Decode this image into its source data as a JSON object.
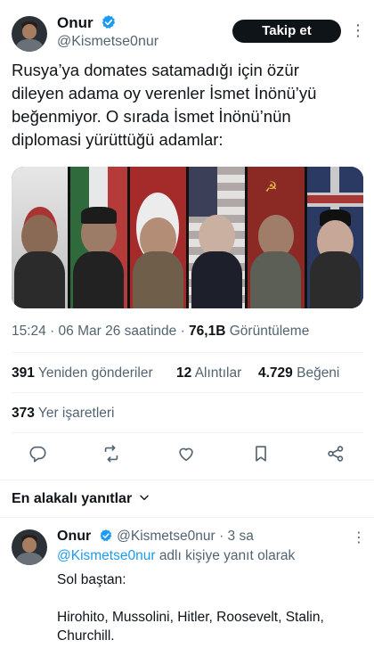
{
  "tweet": {
    "author_name": "Onur",
    "author_handle": "@Kismetse0nur",
    "follow_label": "Takip et",
    "text_lines": [
      "Rusya’ya domates satamadığı için özür",
      "dileyen adama oy verenler İsmet İnönü’yü",
      "beğenmiyor. O sırada İsmet İnönü’nün",
      "diplomasi yürüttüğü adamlar:"
    ],
    "time": "15:24 · 06 Mar 26 saatinde ·",
    "views_count": "76,1B",
    "views_label": "Görüntüleme"
  },
  "stats": {
    "retweets_count": "391",
    "retweets_label": "Yeniden gönderiler",
    "quotes_count": "12",
    "quotes_label": "Alıntılar",
    "likes_count": "4.729",
    "likes_label": "Beğeni",
    "bookmarks_count": "373",
    "bookmarks_label": "Yer işaretleri"
  },
  "actions": {
    "icons": [
      "reply-icon",
      "retweet-icon",
      "like-icon",
      "bookmark-icon",
      "share-icon"
    ]
  },
  "replies": {
    "sort_label": "En alakalı yanıtlar",
    "items": [
      {
        "author_name": "Onur",
        "author_handle": "@Kismetse0nur",
        "time": "· 3 sa",
        "reply_to_mention": "@Kismetse0nur",
        "reply_to_suffix": "adlı kişiye yanıt olarak",
        "text_line1": "Sol baştan:",
        "text_line2": "Hirohito, Mussolini, Hitler, Roosevelt, Stalin,",
        "text_line3": "Churchill."
      }
    ]
  },
  "colors": {
    "accent": "#1d9bf0",
    "text": "#0f1419",
    "secondary": "#536471"
  }
}
